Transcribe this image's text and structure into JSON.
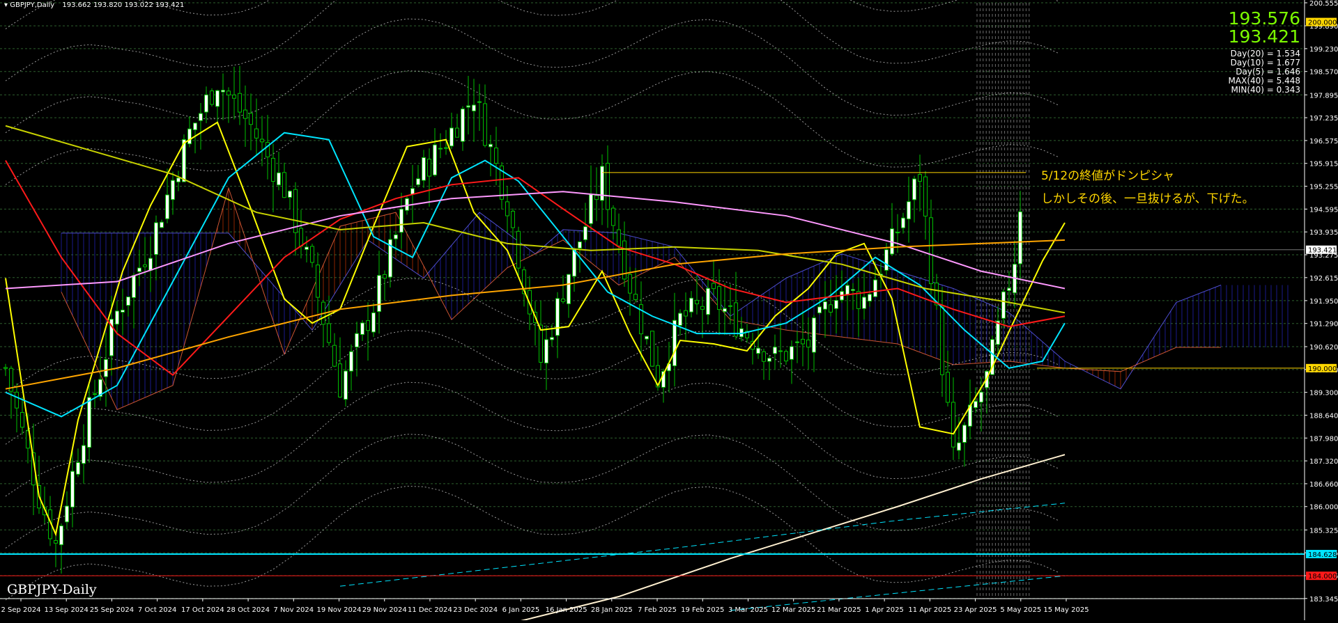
{
  "window": {
    "title": "GBPJPY,Daily",
    "ohlc_text": "193.662 193.820 193.022 193.421",
    "watermark": "GBPJPY-Daily"
  },
  "quotes": {
    "bid": "193.576",
    "ask": "193.421",
    "ask_color": "#7cfc00",
    "stats": [
      "Day(20) = 1.534",
      "Day(10) = 1.677",
      "Day(5) = 1.646",
      "MAX(40) = 5.448",
      "MIN(40) = 0.343"
    ]
  },
  "annotations": {
    "line1": "5/12の終値がドンピシャ",
    "line2": "しかしその後、一旦抜けるが、下げた。",
    "level": 195.65
  },
  "colors": {
    "background": "#000000",
    "bull": "#ffffff",
    "wick": "#00c000",
    "ma_yellow": "#ffff00",
    "ma_cyan": "#00e5ff",
    "ma_red": "#ff1a1a",
    "ma_pink": "#ff99ff",
    "ma_olive": "#c8d200",
    "ma_orange": "#ffa500",
    "ma_cream": "#fff0d0",
    "kumo_red": "#ff4000",
    "kumo_blue": "#3030ff"
  },
  "chart_data": {
    "type": "candlestick",
    "symbol": "GBPJPY",
    "timeframe": "Daily",
    "ylim": [
      183.34,
      200.555
    ],
    "y_ticks": [
      "200.555",
      "199.890",
      "199.230",
      "198.570",
      "197.895",
      "197.235",
      "196.575",
      "195.915",
      "195.255",
      "194.595",
      "193.935",
      "193.275",
      "192.615",
      "191.950",
      "191.290",
      "190.620",
      "189.960",
      "189.300",
      "188.640",
      "187.980",
      "187.320",
      "186.660",
      "186.000",
      "185.325",
      "184.665",
      "184.005",
      "183.345"
    ],
    "price_labels": [
      {
        "text": "200.000",
        "value": 200.0,
        "bg": "#ffd700",
        "fg": "#000000"
      },
      {
        "text": "193.421",
        "value": 193.421,
        "bg": "#ffffff",
        "fg": "#000000"
      },
      {
        "text": "190.000",
        "value": 190.0,
        "bg": "#ffd700",
        "fg": "#000000"
      },
      {
        "text": "184.628",
        "value": 184.628,
        "bg": "#00e5ff",
        "fg": "#000000"
      },
      {
        "text": "184.000",
        "value": 184.0,
        "bg": "#ff1a1a",
        "fg": "#000000"
      }
    ],
    "x_labels": [
      "2 Sep 2024",
      "13 Sep 2024",
      "25 Sep 2024",
      "7 Oct 2024",
      "17 Oct 2024",
      "28 Oct 2024",
      "7 Nov 2024",
      "19 Nov 2024",
      "29 Nov 2024",
      "11 Dec 2024",
      "23 Dec 2024",
      "6 Jan 2025",
      "16 Jan 2025",
      "28 Jan 2025",
      "7 Feb 2025",
      "19 Feb 2025",
      "3 Mar 2025",
      "12 Mar 2025",
      "21 Mar 2025",
      "1 Apr 2025",
      "11 Apr 2025",
      "23 Apr 2025",
      "5 May 2025",
      "15 May 2025"
    ],
    "bars_visible": 183,
    "close_path": [
      [
        0,
        190.0
      ],
      [
        6,
        186.3
      ],
      [
        9,
        184.9
      ],
      [
        13,
        187.6
      ],
      [
        20,
        191.6
      ],
      [
        26,
        193.6
      ],
      [
        33,
        196.8
      ],
      [
        38,
        198.3
      ],
      [
        44,
        197.0
      ],
      [
        50,
        195.2
      ],
      [
        55,
        192.7
      ],
      [
        60,
        189.5
      ],
      [
        66,
        191.8
      ],
      [
        73,
        195.3
      ],
      [
        79,
        196.6
      ],
      [
        84,
        197.9
      ],
      [
        90,
        194.8
      ],
      [
        96,
        190.2
      ],
      [
        101,
        192.8
      ],
      [
        107,
        195.5
      ],
      [
        112,
        192.4
      ],
      [
        117,
        189.7
      ],
      [
        121,
        191.4
      ],
      [
        127,
        192.0
      ],
      [
        133,
        191.0
      ],
      [
        138,
        190.3
      ],
      [
        144,
        190.7
      ],
      [
        149,
        192.3
      ],
      [
        154,
        192.0
      ],
      [
        159,
        193.6
      ],
      [
        164,
        195.6
      ],
      [
        170,
        187.4
      ],
      [
        176,
        189.7
      ],
      [
        181,
        193.2
      ],
      [
        183,
        196.3
      ],
      [
        188,
        194.3
      ],
      [
        190,
        193.4
      ]
    ],
    "indicator_lines": [
      {
        "name": "yellow",
        "pts": [
          [
            0,
            192.6
          ],
          [
            6,
            186.3
          ],
          [
            9,
            185.2
          ],
          [
            13,
            188.5
          ],
          [
            21,
            192.8
          ],
          [
            26,
            194.7
          ],
          [
            32,
            196.5
          ],
          [
            38,
            197.1
          ],
          [
            44,
            194.6
          ],
          [
            50,
            192.0
          ],
          [
            55,
            191.3
          ],
          [
            60,
            191.7
          ],
          [
            66,
            194.1
          ],
          [
            72,
            196.4
          ],
          [
            79,
            196.6
          ],
          [
            84,
            194.5
          ],
          [
            90,
            193.4
          ],
          [
            96,
            191.1
          ],
          [
            101,
            191.2
          ],
          [
            107,
            192.8
          ],
          [
            112,
            191.0
          ],
          [
            117,
            189.5
          ],
          [
            121,
            190.8
          ],
          [
            127,
            190.7
          ],
          [
            133,
            190.5
          ],
          [
            138,
            191.5
          ],
          [
            144,
            192.3
          ],
          [
            149,
            193.3
          ],
          [
            154,
            193.6
          ],
          [
            159,
            192.0
          ],
          [
            164,
            188.3
          ],
          [
            170,
            188.1
          ],
          [
            176,
            189.7
          ],
          [
            181,
            191.4
          ],
          [
            186,
            193.1
          ],
          [
            190,
            194.2
          ]
        ]
      },
      {
        "name": "cyan",
        "pts": [
          [
            0,
            189.3
          ],
          [
            10,
            188.6
          ],
          [
            20,
            189.5
          ],
          [
            30,
            192.5
          ],
          [
            40,
            195.5
          ],
          [
            50,
            196.8
          ],
          [
            58,
            196.6
          ],
          [
            66,
            193.8
          ],
          [
            73,
            193.2
          ],
          [
            80,
            195.5
          ],
          [
            86,
            196.0
          ],
          [
            92,
            195.4
          ],
          [
            100,
            193.8
          ],
          [
            108,
            192.2
          ],
          [
            116,
            191.5
          ],
          [
            124,
            191.0
          ],
          [
            132,
            191.0
          ],
          [
            140,
            191.3
          ],
          [
            148,
            192.1
          ],
          [
            156,
            193.2
          ],
          [
            164,
            192.4
          ],
          [
            172,
            191.1
          ],
          [
            180,
            190.0
          ],
          [
            186,
            190.2
          ],
          [
            190,
            191.3
          ]
        ]
      },
      {
        "name": "red",
        "pts": [
          [
            0,
            196.0
          ],
          [
            10,
            193.2
          ],
          [
            20,
            191.0
          ],
          [
            30,
            189.8
          ],
          [
            40,
            191.5
          ],
          [
            50,
            193.2
          ],
          [
            60,
            194.3
          ],
          [
            70,
            194.9
          ],
          [
            80,
            195.3
          ],
          [
            92,
            195.5
          ],
          [
            100,
            194.6
          ],
          [
            110,
            193.5
          ],
          [
            120,
            193.0
          ],
          [
            130,
            192.3
          ],
          [
            140,
            191.9
          ],
          [
            150,
            192.1
          ],
          [
            160,
            192.3
          ],
          [
            170,
            191.7
          ],
          [
            180,
            191.2
          ],
          [
            190,
            191.5
          ]
        ]
      },
      {
        "name": "pink",
        "pts": [
          [
            0,
            192.3
          ],
          [
            20,
            192.5
          ],
          [
            40,
            193.6
          ],
          [
            60,
            194.4
          ],
          [
            80,
            194.9
          ],
          [
            100,
            195.1
          ],
          [
            120,
            194.8
          ],
          [
            140,
            194.4
          ],
          [
            160,
            193.6
          ],
          [
            175,
            192.8
          ],
          [
            190,
            192.3
          ]
        ]
      },
      {
        "name": "olive",
        "pts": [
          [
            0,
            197.0
          ],
          [
            15,
            196.3
          ],
          [
            30,
            195.6
          ],
          [
            45,
            194.5
          ],
          [
            60,
            194.0
          ],
          [
            75,
            194.2
          ],
          [
            90,
            193.6
          ],
          [
            105,
            193.4
          ],
          [
            120,
            193.5
          ],
          [
            135,
            193.4
          ],
          [
            150,
            193.0
          ],
          [
            165,
            192.3
          ],
          [
            180,
            191.9
          ],
          [
            190,
            191.6
          ]
        ]
      },
      {
        "name": "orange",
        "pts": [
          [
            0,
            189.4
          ],
          [
            20,
            190.0
          ],
          [
            40,
            190.9
          ],
          [
            60,
            191.7
          ],
          [
            80,
            192.1
          ],
          [
            100,
            192.4
          ],
          [
            120,
            193.0
          ],
          [
            140,
            193.3
          ],
          [
            160,
            193.5
          ],
          [
            175,
            193.6
          ],
          [
            190,
            193.7
          ]
        ]
      },
      {
        "name": "cream",
        "pts": [
          [
            80,
            182.2
          ],
          [
            110,
            183.4
          ],
          [
            130,
            184.5
          ],
          [
            160,
            186.0
          ],
          [
            175,
            186.8
          ],
          [
            190,
            187.5
          ]
        ]
      }
    ]
  }
}
